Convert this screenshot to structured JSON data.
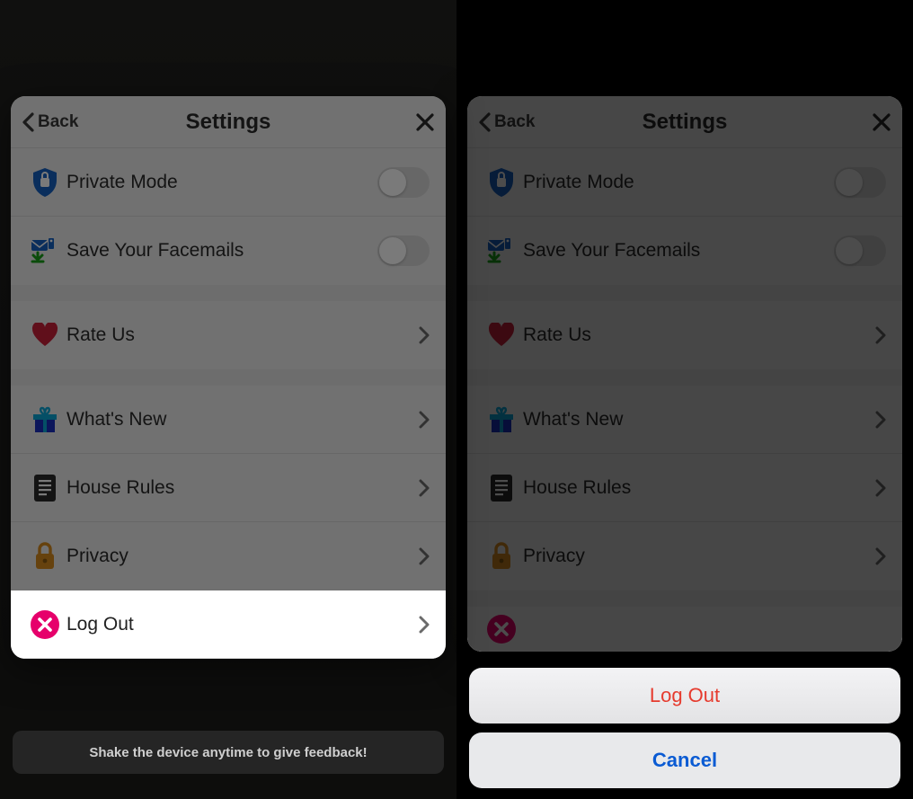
{
  "screens": {
    "left": {
      "header": {
        "back": "Back",
        "title": "Settings"
      },
      "rows": {
        "private_mode": "Private Mode",
        "save_facemails": "Save Your Facemails",
        "rate_us": "Rate Us",
        "whats_new": "What's New",
        "house_rules": "House Rules",
        "privacy": "Privacy",
        "log_out": "Log Out"
      },
      "feedback": "Shake the device anytime to give feedback!"
    },
    "right": {
      "header": {
        "back": "Back",
        "title": "Settings"
      },
      "rows": {
        "private_mode": "Private Mode",
        "save_facemails": "Save Your Facemails",
        "rate_us": "Rate Us",
        "whats_new": "What's New",
        "house_rules": "House Rules",
        "privacy": "Privacy"
      },
      "action_sheet": {
        "log_out": "Log Out",
        "cancel": "Cancel"
      }
    }
  }
}
